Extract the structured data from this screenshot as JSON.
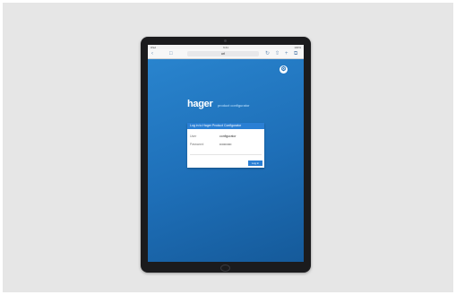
{
  "statusbar": {
    "left": "iPad",
    "time": "9:41",
    "right": "100%"
  },
  "browser": {
    "back_icon": "chevron-left-icon",
    "url": "url"
  },
  "brand": {
    "name": "hager",
    "subtitle": "product configurator"
  },
  "dialog": {
    "title": "Log in to Hager Product Configurator",
    "user_label": "User",
    "user_value": "configurator",
    "password_label": "Password",
    "password_value": "•••••••••••",
    "login_label": "Log in"
  },
  "colors": {
    "screen": "#1e6fb8",
    "accent": "#2a7fd4"
  }
}
